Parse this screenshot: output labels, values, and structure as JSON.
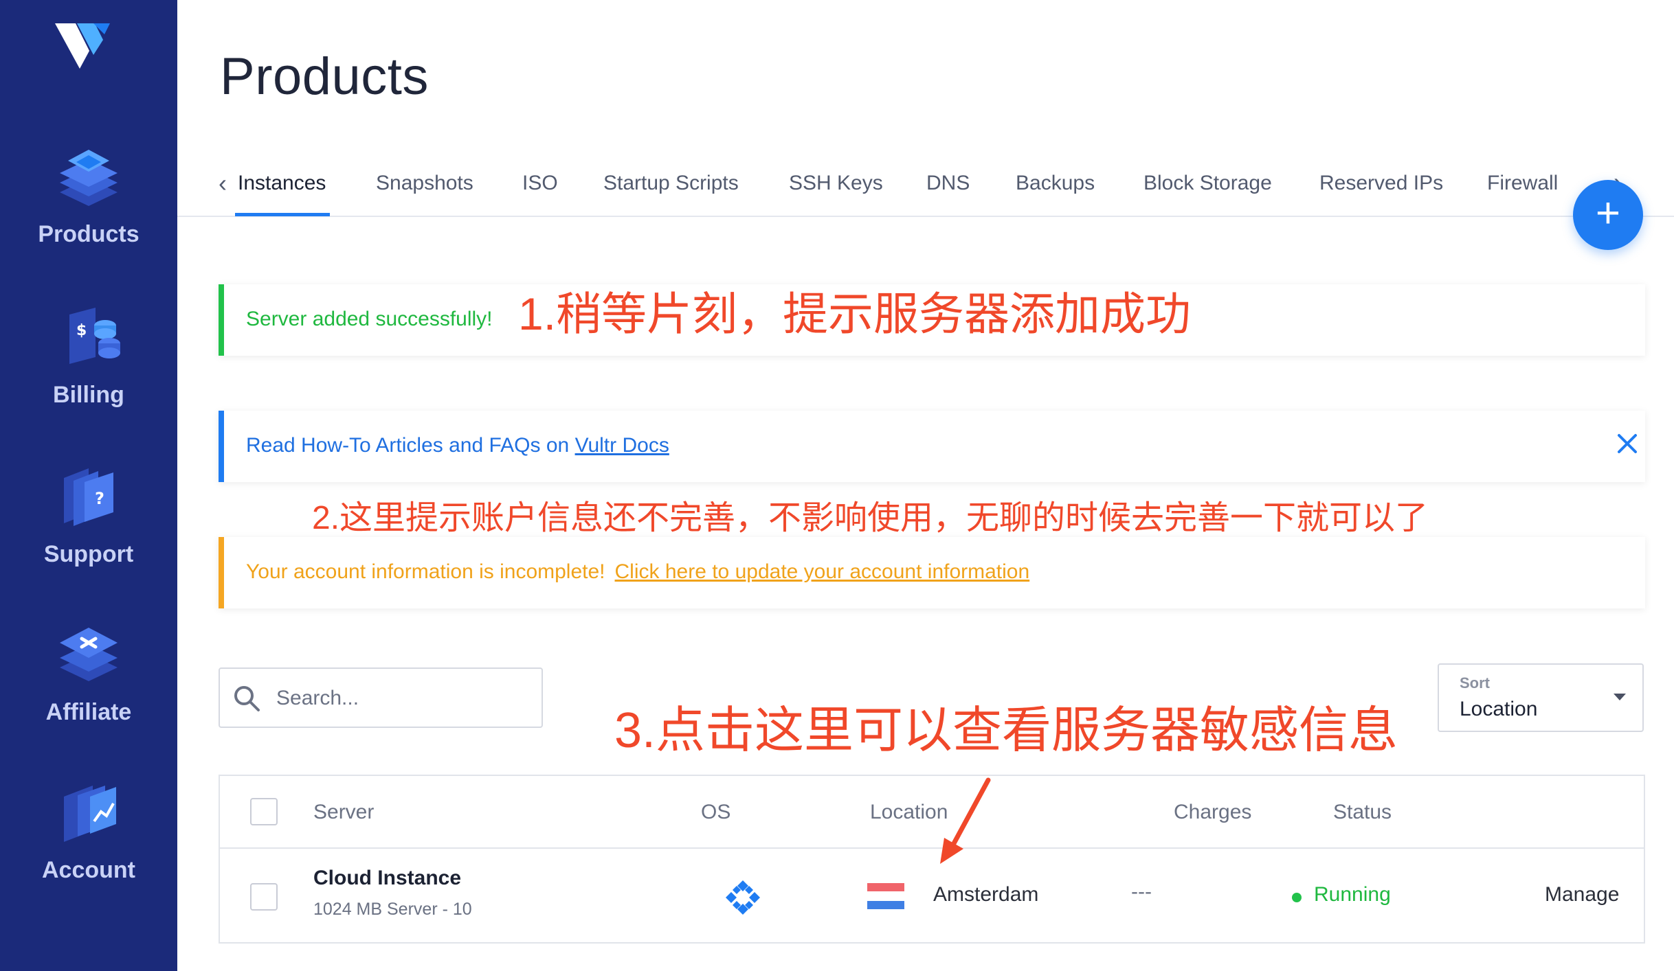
{
  "sidebar": {
    "items": [
      {
        "label": "Products",
        "icon": "products-icon"
      },
      {
        "label": "Billing",
        "icon": "billing-icon"
      },
      {
        "label": "Support",
        "icon": "support-icon"
      },
      {
        "label": "Affiliate",
        "icon": "affiliate-icon"
      },
      {
        "label": "Account",
        "icon": "account-icon"
      }
    ]
  },
  "page": {
    "title": "Products"
  },
  "tabs": [
    {
      "label": "Instances"
    },
    {
      "label": "Snapshots"
    },
    {
      "label": "ISO"
    },
    {
      "label": "Startup Scripts"
    },
    {
      "label": "SSH Keys"
    },
    {
      "label": "DNS"
    },
    {
      "label": "Backups"
    },
    {
      "label": "Block Storage"
    },
    {
      "label": "Reserved IPs"
    },
    {
      "label": "Firewall"
    }
  ],
  "fab": {
    "label": "+"
  },
  "alerts": {
    "success": {
      "text": "Server added successfully!"
    },
    "info": {
      "text": "Read How-To Articles and FAQs on ",
      "link": "Vultr Docs"
    },
    "warning": {
      "text": "Your account information is incomplete!",
      "link": "Click here to update your account information"
    }
  },
  "annotations": {
    "a1": "1.稍等片刻，提示服务器添加成功",
    "a2": "2.这里提示账户信息还不完善，不影响使用，无聊的时候去完善一下就可以了",
    "a3": "3.点击这里可以查看服务器敏感信息"
  },
  "search": {
    "placeholder": "Search..."
  },
  "sort": {
    "label": "Sort",
    "value": "Location"
  },
  "table": {
    "headers": {
      "server": "Server",
      "os": "OS",
      "location": "Location",
      "charges": "Charges",
      "status": "Status"
    },
    "rows": [
      {
        "name": "Cloud Instance",
        "sub": "1024 MB Server - 10",
        "location": "Amsterdam",
        "charges": "---",
        "status": "Running",
        "action": "Manage"
      }
    ]
  },
  "colors": {
    "sidebar": "#1b2a7a",
    "accent": "#1f7cf2",
    "success": "#22c24b",
    "warning": "#f5a623",
    "annotation": "#f0482a"
  }
}
